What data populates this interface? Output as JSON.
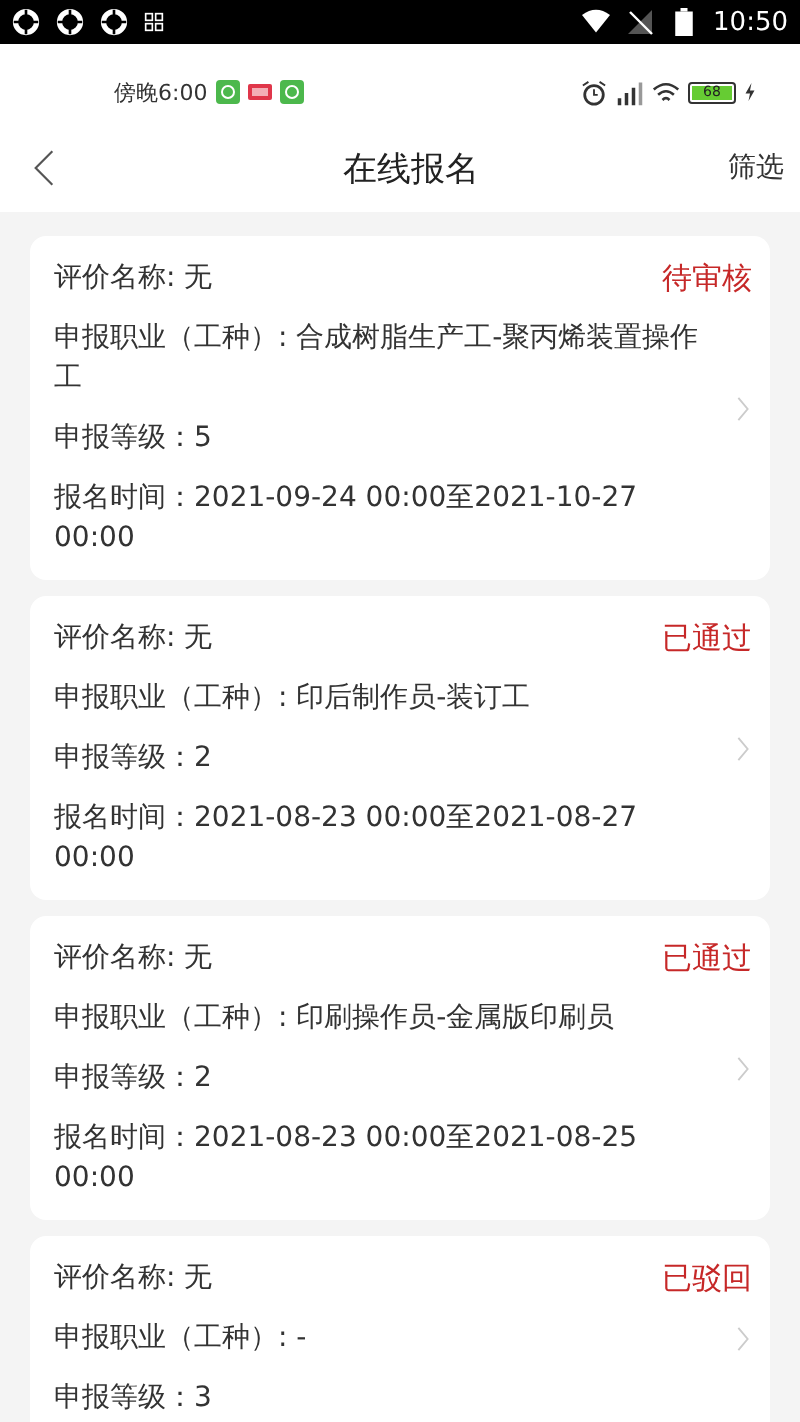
{
  "system_bar": {
    "time": "10:50"
  },
  "inner_status_bar": {
    "time": "傍晚6:00",
    "battery": "68"
  },
  "nav": {
    "title": "在线报名",
    "action": "筛选"
  },
  "cards": [
    {
      "status": "待审核",
      "rows": [
        "评价名称: 无",
        "申报职业（工种）: 合成树脂生产工-聚丙烯装置操作工",
        "申报等级：5",
        "报名时间：2021-09-24 00:00至2021-10-27 00:00"
      ]
    },
    {
      "status": "已通过",
      "rows": [
        "评价名称: 无",
        "申报职业（工种）: 印后制作员-装订工",
        "申报等级：2",
        "报名时间：2021-08-23 00:00至2021-08-27 00:00"
      ]
    },
    {
      "status": "已通过",
      "rows": [
        "评价名称: 无",
        "申报职业（工种）: 印刷操作员-金属版印刷员",
        "申报等级：2",
        "报名时间：2021-08-23 00:00至2021-08-25 00:00"
      ]
    },
    {
      "status": "已驳回",
      "rows": [
        "评价名称: 无",
        "申报职业（工种）: -",
        "申报等级：3"
      ]
    }
  ]
}
